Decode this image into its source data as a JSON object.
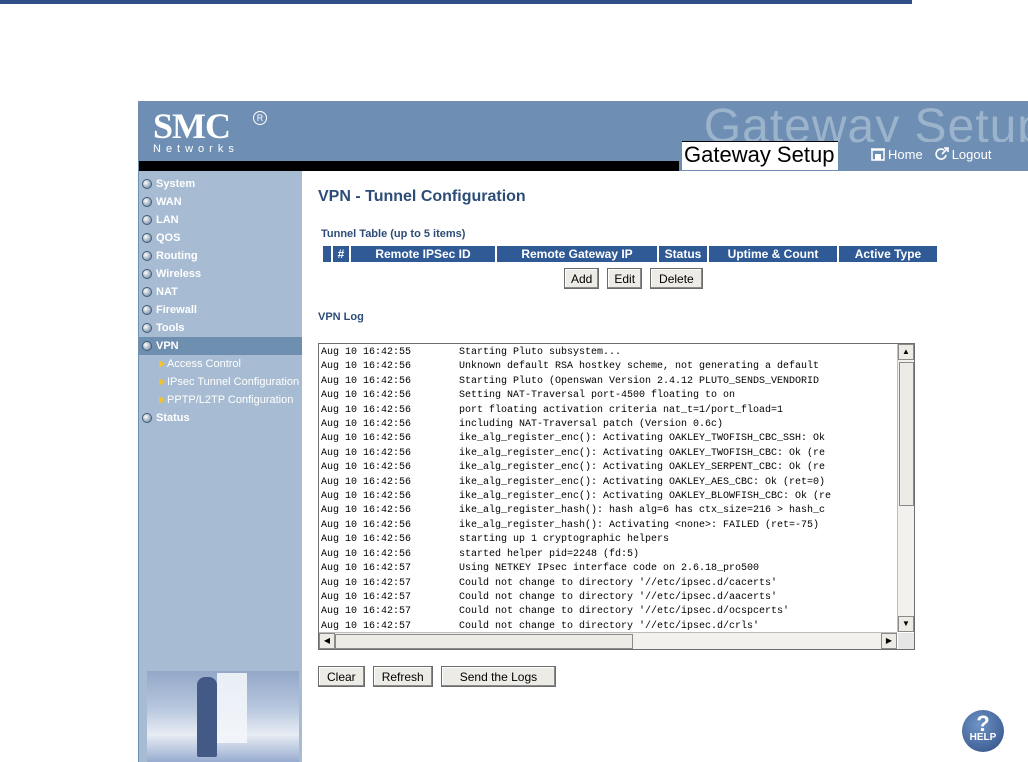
{
  "brand": {
    "logo": "SMC",
    "reg": "R",
    "networks": "Networks",
    "watermark": "Gateway Setup",
    "title": "Gateway Setup"
  },
  "nav": {
    "home": "Home",
    "logout": "Logout"
  },
  "sidebar": {
    "items": [
      {
        "label": "System"
      },
      {
        "label": "WAN"
      },
      {
        "label": "LAN"
      },
      {
        "label": "QOS"
      },
      {
        "label": "Routing"
      },
      {
        "label": "Wireless"
      },
      {
        "label": "NAT"
      },
      {
        "label": "Firewall"
      },
      {
        "label": "Tools"
      },
      {
        "label": "VPN"
      },
      {
        "label": "Status"
      }
    ],
    "vpn_sub": [
      {
        "label": "Access Control"
      },
      {
        "label": "IPsec Tunnel Configuration"
      },
      {
        "label": "PPTP/L2TP Configuration"
      }
    ]
  },
  "main": {
    "title": "VPN - Tunnel Configuration",
    "tunnel_table_label": "Tunnel Table (up to 5 items)",
    "columns": [
      "#",
      "Remote IPSec ID",
      "Remote Gateway IP",
      "Status",
      "Uptime & Count",
      "Active Type"
    ],
    "buttons": {
      "add": "Add",
      "edit": "Edit",
      "delete": "Delete"
    },
    "vpn_log_label": "VPN Log",
    "log": [
      {
        "ts": "Aug 10 16:42:55",
        "msg": "Starting Pluto subsystem..."
      },
      {
        "ts": "Aug 10 16:42:56",
        "msg": "Unknown default RSA hostkey scheme, not generating a default"
      },
      {
        "ts": "Aug 10 16:42:56",
        "msg": "Starting Pluto (Openswan Version 2.4.12 PLUTO_SENDS_VENDORID"
      },
      {
        "ts": "Aug 10 16:42:56",
        "msg": "Setting NAT-Traversal port-4500 floating to on"
      },
      {
        "ts": "Aug 10 16:42:56",
        "msg": "port floating activation criteria nat_t=1/port_fload=1"
      },
      {
        "ts": "Aug 10 16:42:56",
        "msg": "including NAT-Traversal patch (Version 0.6c)"
      },
      {
        "ts": "Aug 10 16:42:56",
        "msg": "ike_alg_register_enc(): Activating OAKLEY_TWOFISH_CBC_SSH: Ok"
      },
      {
        "ts": "Aug 10 16:42:56",
        "msg": "ike_alg_register_enc(): Activating OAKLEY_TWOFISH_CBC: Ok (re"
      },
      {
        "ts": "Aug 10 16:42:56",
        "msg": "ike_alg_register_enc(): Activating OAKLEY_SERPENT_CBC: Ok (re"
      },
      {
        "ts": "Aug 10 16:42:56",
        "msg": "ike_alg_register_enc(): Activating OAKLEY_AES_CBC: Ok (ret=0)"
      },
      {
        "ts": "Aug 10 16:42:56",
        "msg": "ike_alg_register_enc(): Activating OAKLEY_BLOWFISH_CBC: Ok (re"
      },
      {
        "ts": "Aug 10 16:42:56",
        "msg": "ike_alg_register_hash(): hash alg=6 has ctx_size=216 > hash_c"
      },
      {
        "ts": "Aug 10 16:42:56",
        "msg": "ike_alg_register_hash(): Activating <none>: FAILED (ret=-75)"
      },
      {
        "ts": "Aug 10 16:42:56",
        "msg": "starting up 1 cryptographic helpers"
      },
      {
        "ts": "Aug 10 16:42:56",
        "msg": "started helper pid=2248 (fd:5)"
      },
      {
        "ts": "Aug 10 16:42:57",
        "msg": "Using NETKEY IPsec interface code on 2.6.18_pro500"
      },
      {
        "ts": "Aug 10 16:42:57",
        "msg": "Could not change to directory '//etc/ipsec.d/cacerts'"
      },
      {
        "ts": "Aug 10 16:42:57",
        "msg": "Could not change to directory '//etc/ipsec.d/aacerts'"
      },
      {
        "ts": "Aug 10 16:42:57",
        "msg": "Could not change to directory '//etc/ipsec.d/ocspcerts'"
      },
      {
        "ts": "Aug 10 16:42:57",
        "msg": "Could not change to directory '//etc/ipsec.d/crls'"
      }
    ],
    "log_buttons": {
      "clear": "Clear",
      "refresh": "Refresh",
      "send": "Send the Logs"
    },
    "help": {
      "symbol": "?",
      "label": "HELP"
    }
  },
  "icons": {
    "home": "home-icon",
    "logout": "logout-icon",
    "help": "help-icon",
    "bullet": "bullet-icon",
    "submenu": "triangle-right-icon"
  },
  "colors": {
    "header": "#6e8fb3",
    "sidebar": "#a7bcd2",
    "title": "#2d4d78",
    "table_header": "#2f5a96"
  }
}
